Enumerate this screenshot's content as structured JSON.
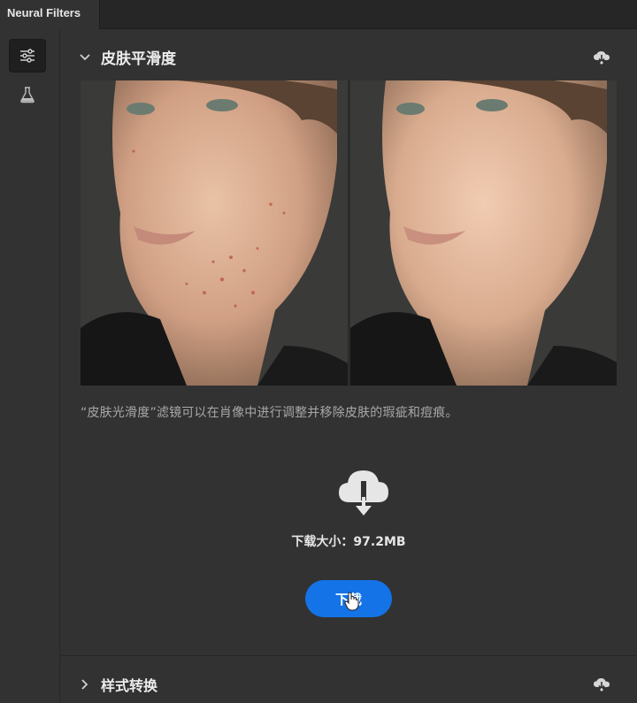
{
  "tab": {
    "title": "Neural Filters"
  },
  "rail": {
    "items": [
      {
        "icon": "sliders-icon",
        "active": true
      },
      {
        "icon": "beaker-icon",
        "active": false
      }
    ]
  },
  "filters": [
    {
      "title": "皮肤平滑度",
      "expanded": true,
      "icon": "cloud-download-icon",
      "description": "“皮肤光滑度”滤镜可以在肖像中进行调整并移除皮肤的瑕疵和痘痕。",
      "download_size_label": "下载大小：97.2MB",
      "download_button": "下载"
    },
    {
      "title": "样式转换",
      "expanded": false,
      "icon": "cloud-download-icon"
    }
  ],
  "colors": {
    "accent": "#1473e6",
    "panel": "#323232",
    "tabbar": "#262626"
  }
}
